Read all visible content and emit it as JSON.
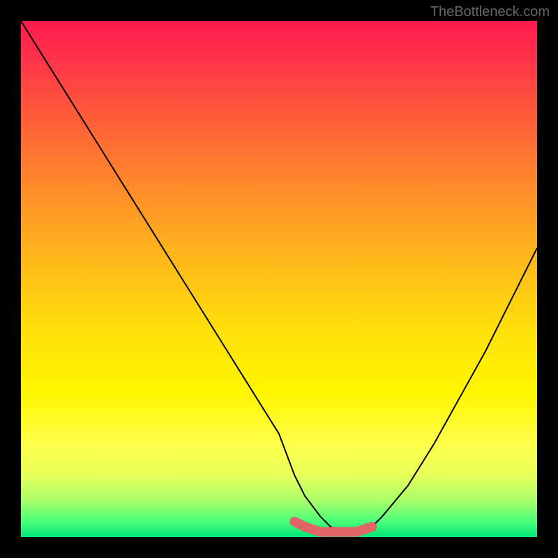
{
  "watermark": "TheBottleneck.com",
  "chart_data": {
    "type": "line",
    "title": "",
    "xlabel": "",
    "ylabel": "",
    "xlim": [
      0,
      100
    ],
    "ylim": [
      0,
      100
    ],
    "series": [
      {
        "name": "bottleneck-curve",
        "x": [
          0,
          5,
          10,
          15,
          20,
          25,
          30,
          35,
          40,
          45,
          50,
          53,
          55,
          58,
          60,
          62,
          65,
          68,
          70,
          75,
          80,
          85,
          90,
          95,
          100
        ],
        "values": [
          100,
          92,
          84,
          76,
          68,
          60,
          52,
          44,
          36,
          28,
          20,
          12,
          8,
          4,
          2,
          1,
          1,
          2,
          4,
          10,
          18,
          27,
          36,
          46,
          56
        ]
      },
      {
        "name": "highlight-band",
        "x": [
          53,
          55,
          58,
          60,
          62,
          65,
          68
        ],
        "values": [
          3,
          2,
          1,
          1,
          1,
          1,
          2
        ]
      }
    ],
    "annotations": [
      {
        "type": "marker",
        "x": 68,
        "y": 2,
        "label": "optimal-point"
      }
    ],
    "gradient_stops": [
      {
        "pos": 0.0,
        "color": "#ff1a4d"
      },
      {
        "pos": 0.18,
        "color": "#ff5a3a"
      },
      {
        "pos": 0.46,
        "color": "#ffb81a"
      },
      {
        "pos": 0.72,
        "color": "#fff600"
      },
      {
        "pos": 0.93,
        "color": "#a8ff6a"
      },
      {
        "pos": 1.0,
        "color": "#00e676"
      }
    ]
  }
}
